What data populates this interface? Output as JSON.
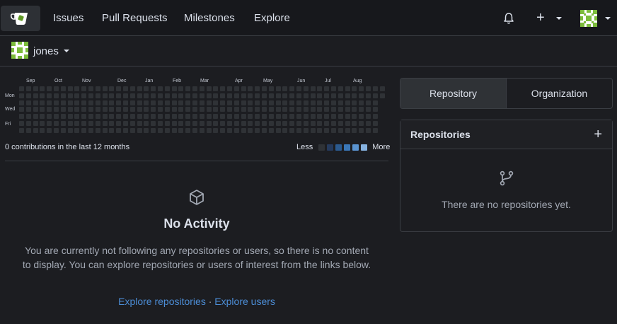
{
  "nav": {
    "links": [
      "Issues",
      "Pull Requests",
      "Milestones",
      "Explore"
    ]
  },
  "context": {
    "username": "jones"
  },
  "heatmap": {
    "months": [
      "Sep",
      "Oct",
      "Nov",
      "Dec",
      "Jan",
      "Feb",
      "Mar",
      "Apr",
      "May",
      "Jun",
      "Jul",
      "Aug"
    ],
    "days": [
      "Mon",
      "Wed",
      "Fri"
    ],
    "contributions_text": "0 contributions in the last 12 months",
    "legend_less": "Less",
    "legend_more": "More",
    "legend_colors": [
      "#2f3236",
      "#253a5c",
      "#2b5a8f",
      "#3a77b8",
      "#5a93d0",
      "#86b2e0"
    ]
  },
  "feed": {
    "title": "No Activity",
    "description": "You are currently not following any repositories or users, so there is no content to display. You can explore repositories or users of interest from the links below.",
    "link_repos": "Explore repositories",
    "separator": "·",
    "link_users": "Explore users"
  },
  "sidebar": {
    "tabs": [
      "Repository",
      "Organization"
    ],
    "repos_title": "Repositories",
    "repos_empty": "There are no repositories yet."
  },
  "colors": {
    "accent_link": "#4c8dd6",
    "logo_green": "#609926",
    "background": "#1c1d21"
  }
}
